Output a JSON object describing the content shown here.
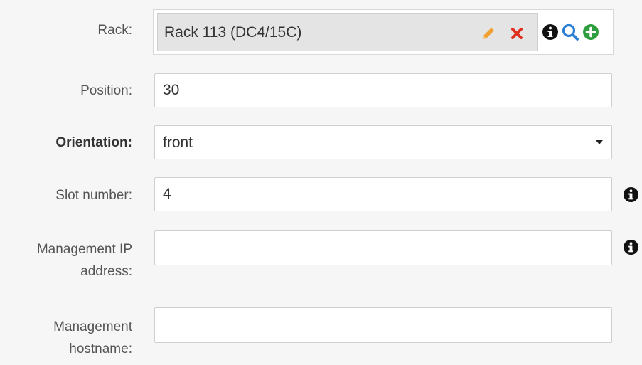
{
  "rack": {
    "label": "Rack:",
    "value": "Rack 113 (DC4/15C)",
    "icons": [
      "pencil-icon",
      "close-icon",
      "info-icon",
      "search-icon",
      "plus-circle-icon"
    ],
    "colors": {
      "edit": "#f0a030",
      "remove": "#e03020",
      "info": "#111111",
      "search": "#2a7fd4",
      "add": "#2e9e3e"
    }
  },
  "position": {
    "label": "Position:",
    "value": "30"
  },
  "orientation": {
    "label": "Orientation:",
    "value": "front"
  },
  "slot_number": {
    "label": "Slot number:",
    "value": "4"
  },
  "management_ip": {
    "label_line1": "Management IP",
    "label_line2": "address:",
    "value": ""
  },
  "management_hostname": {
    "label_line1": "Management",
    "label_line2": "hostname:",
    "value": ""
  }
}
